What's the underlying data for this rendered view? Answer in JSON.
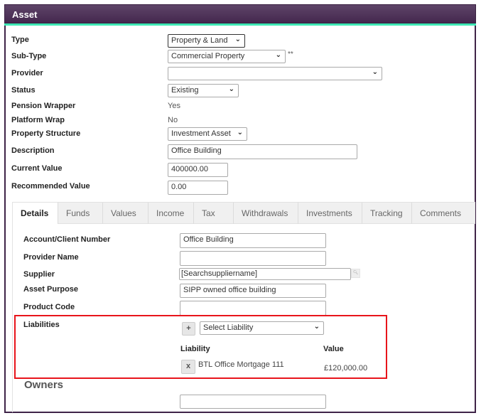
{
  "panel": {
    "title": "Asset",
    "accent_color": "#3de8b4",
    "header_color": "#4a2f55"
  },
  "form": {
    "type": {
      "label": "Type",
      "value": "Property & Land"
    },
    "sub_type": {
      "label": "Sub-Type",
      "value": "Commercial Property",
      "suffix": "**"
    },
    "provider": {
      "label": "Provider",
      "value": ""
    },
    "status": {
      "label": "Status",
      "value": "Existing"
    },
    "pension_wrapper": {
      "label": "Pension Wrapper",
      "value": "Yes"
    },
    "platform_wrap": {
      "label": "Platform Wrap",
      "value": "No"
    },
    "property_structure": {
      "label": "Property Structure",
      "value": "Investment Asset"
    },
    "description": {
      "label": "Description",
      "value": "Office Building"
    },
    "current_value": {
      "label": "Current Value",
      "value": "400000.00"
    },
    "recommended_value": {
      "label": "Recommended Value",
      "value": "0.00"
    }
  },
  "tabs": [
    {
      "label": "Details",
      "active": true
    },
    {
      "label": "Funds"
    },
    {
      "label": "Values"
    },
    {
      "label": "Income"
    },
    {
      "label": "Tax"
    },
    {
      "label": "Withdrawals"
    },
    {
      "label": "Investments"
    },
    {
      "label": "Tracking"
    },
    {
      "label": "Comments"
    }
  ],
  "details": {
    "account_client_number": {
      "label": "Account/Client Number",
      "value": "Office Building"
    },
    "provider_name": {
      "label": "Provider Name",
      "value": ""
    },
    "supplier": {
      "label": "Supplier",
      "value": "[Searchsuppliername]",
      "search_icon": "search-icon"
    },
    "asset_purpose": {
      "label": "Asset Purpose",
      "value": "SIPP owned office building"
    },
    "product_code": {
      "label": "Product Code",
      "value": ""
    },
    "liabilities": {
      "label": "Liabilities",
      "add_label": "+",
      "select_placeholder": "Select Liability",
      "col_liability": "Liability",
      "col_value": "Value",
      "rows": [
        {
          "remove_label": "x",
          "name": "BTL Office Mortgage 111",
          "value": "£120,000.00"
        }
      ]
    },
    "owners": {
      "heading": "Owners",
      "value": ""
    }
  },
  "chevron": "⌄"
}
